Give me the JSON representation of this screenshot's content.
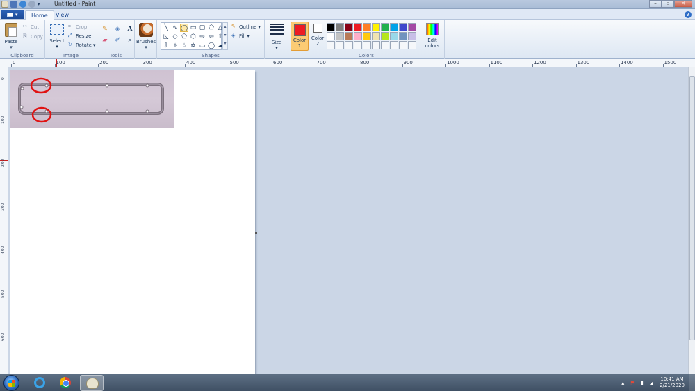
{
  "window": {
    "title": "Untitled - Paint"
  },
  "tabs": {
    "home": "Home",
    "view": "View"
  },
  "clipboard": {
    "paste": "Paste",
    "cut": "Cut",
    "copy": "Copy",
    "label": "Clipboard"
  },
  "image": {
    "select": "Select",
    "crop": "Crop",
    "resize": "Resize",
    "rotate": "Rotate",
    "label": "Image"
  },
  "tools": {
    "label": "Tools",
    "text_tool": "A"
  },
  "brushes": {
    "label": "Brushes"
  },
  "shapes": {
    "outline": "Outline",
    "fill": "Fill",
    "label": "Shapes"
  },
  "size": {
    "label": "Size"
  },
  "colors": {
    "color1_label": "Color",
    "color1_num": "1",
    "color2_label": "Color",
    "color2_num": "2",
    "edit_label": "Edit",
    "edit_label2": "colors",
    "label": "Colors",
    "color1": "#ed1c24",
    "color2": "#ffffff",
    "palette": [
      "#000000",
      "#7f7f7f",
      "#880015",
      "#ed1c24",
      "#ff7f27",
      "#fff200",
      "#22b14c",
      "#00a2e8",
      "#3f48cc",
      "#a349a4",
      "#ffffff",
      "#c3c3c3",
      "#b97a57",
      "#ffaec9",
      "#ffc90e",
      "#efe4b0",
      "#b5e61d",
      "#99d9ea",
      "#7092be",
      "#c8bfe7",
      "#f5f7fa",
      "#f5f7fa",
      "#f5f7fa",
      "#f5f7fa",
      "#f5f7fa",
      "#f5f7fa",
      "#f5f7fa",
      "#f5f7fa",
      "#f5f7fa",
      "#f5f7fa"
    ]
  },
  "ruler": {
    "h_labels": [
      "0",
      "100",
      "200",
      "300",
      "400",
      "500",
      "600",
      "700",
      "800",
      "900",
      "1000",
      "1100",
      "1200",
      "1300",
      "1400",
      "1500"
    ],
    "v_labels": [
      "0",
      "100",
      "200",
      "300",
      "400",
      "500",
      "600"
    ]
  },
  "taskbar": {
    "time": "10:41 AM",
    "date": "2/21/2020"
  }
}
